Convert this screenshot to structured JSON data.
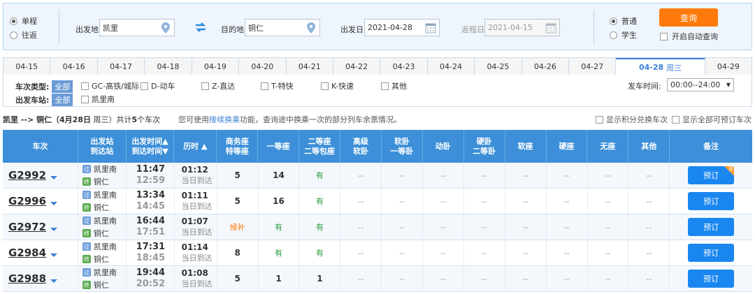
{
  "query": {
    "trip_types": [
      "单程",
      "往返"
    ],
    "trip_selected": 0,
    "from_label": "出发地",
    "from_value": "凯里",
    "to_label": "目的地",
    "to_value": "铜仁",
    "depart_label": "出发日",
    "depart_value": "2021-04-28",
    "return_label": "返程日",
    "return_value": "2021-04-15",
    "passenger_types": [
      "普通",
      "学生"
    ],
    "passenger_selected": 0,
    "query_button": "查询",
    "auto_query_label": "开启自动查询"
  },
  "date_tabs": [
    {
      "date": "04-15"
    },
    {
      "date": "04-16"
    },
    {
      "date": "04-17"
    },
    {
      "date": "04-18"
    },
    {
      "date": "04-19"
    },
    {
      "date": "04-20"
    },
    {
      "date": "04-21"
    },
    {
      "date": "04-22"
    },
    {
      "date": "04-23"
    },
    {
      "date": "04-24"
    },
    {
      "date": "04-25"
    },
    {
      "date": "04-26"
    },
    {
      "date": "04-27"
    },
    {
      "date": "04-28",
      "weekday": "周三",
      "active": true
    },
    {
      "date": "04-29"
    }
  ],
  "filter": {
    "type_label": "车次类型:",
    "all_label": "全部",
    "types": [
      "GC-高铁/城际",
      "D-动车",
      "Z-直达",
      "T-特快",
      "K-快速",
      "其他"
    ],
    "station_label": "出发车站:",
    "stations": [
      "凯里南"
    ],
    "time_label": "发车时间:",
    "time_value": "00:00--24:00"
  },
  "summary": {
    "route": "凯里 --> 铜仁（",
    "date": "4月28日",
    "weekday": " 周三）共计",
    "count": "5",
    "count_suffix": "个车次",
    "tip_prefix": "您可使用",
    "tip_link": "接续换乘",
    "tip_suffix": "功能，查询途中换乘一次的部分列车余票情况。",
    "opt_points": "显示积分兑换车次",
    "opt_all": "显示全部可预订车次"
  },
  "table": {
    "headers": [
      {
        "lines": [
          "车次"
        ]
      },
      {
        "lines": [
          "出发站",
          "到达站"
        ]
      },
      {
        "lines": [
          "出发时间▲",
          "到达时间▼"
        ]
      },
      {
        "lines": [
          "历时 ▲"
        ]
      },
      {
        "lines": [
          "商务座",
          "特等座"
        ]
      },
      {
        "lines": [
          "一等座"
        ]
      },
      {
        "lines": [
          "二等座",
          "二等包座"
        ]
      },
      {
        "lines": [
          "高级",
          "软卧"
        ]
      },
      {
        "lines": [
          "软卧",
          "一等卧"
        ]
      },
      {
        "lines": [
          "动卧"
        ]
      },
      {
        "lines": [
          "硬卧",
          "二等卧"
        ]
      },
      {
        "lines": [
          "软座"
        ]
      },
      {
        "lines": [
          "硬座"
        ]
      },
      {
        "lines": [
          "无座"
        ]
      },
      {
        "lines": [
          "其他"
        ]
      },
      {
        "lines": [
          "备注"
        ]
      }
    ],
    "pass_badge": "过",
    "end_badge": "终",
    "same_day": "当日到达",
    "book_label": "预订",
    "points_badge": "兑",
    "rows": [
      {
        "train": "G2992",
        "from": "凯里南",
        "to": "铜仁",
        "dep": "11:47",
        "arr": "12:59",
        "dur": "01:12",
        "biz": "5",
        "first": "14",
        "second": "有",
        "points": true
      },
      {
        "train": "G2996",
        "from": "凯里南",
        "to": "铜仁",
        "dep": "13:34",
        "arr": "14:45",
        "dur": "01:11",
        "biz": "5",
        "first": "16",
        "second": "有",
        "points": false
      },
      {
        "train": "G2972",
        "from": "凯里南",
        "to": "铜仁",
        "dep": "16:44",
        "arr": "17:51",
        "dur": "01:07",
        "biz": "候补",
        "first": "有",
        "second": "有",
        "points": false
      },
      {
        "train": "G2984",
        "from": "凯里南",
        "to": "铜仁",
        "dep": "17:31",
        "arr": "18:45",
        "dur": "01:14",
        "biz": "8",
        "first": "有",
        "second": "有",
        "points": false
      },
      {
        "train": "G2988",
        "from": "凯里南",
        "to": "铜仁",
        "dep": "19:44",
        "arr": "20:52",
        "dur": "01:08",
        "biz": "5",
        "first": "1",
        "second": "1",
        "points": false
      }
    ],
    "empty": "--"
  }
}
